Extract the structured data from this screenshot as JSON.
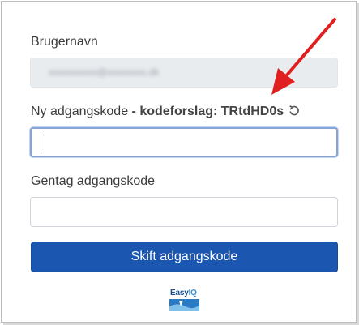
{
  "form": {
    "username_label": "Brugernavn",
    "username_value": "xxxxxxxxxx@xxxxxxxx.dk",
    "new_password_label": "Ny adgangskode",
    "suggestion_separator": " - ",
    "suggestion_text": "kodeforslag: TRtdHD0s",
    "new_password_value": "",
    "repeat_password_label": "Gentag adgangskode",
    "repeat_password_value": "",
    "submit_label": "Skift adgangskode"
  },
  "logo": {
    "text_easy": "Easy",
    "text_iq": "IQ"
  },
  "icons": {
    "refresh": "refresh-icon",
    "annotation": "red-arrow"
  },
  "colors": {
    "primary": "#1b56b0",
    "annotation_arrow": "#e02020",
    "readonly_bg": "#e9ecef"
  }
}
